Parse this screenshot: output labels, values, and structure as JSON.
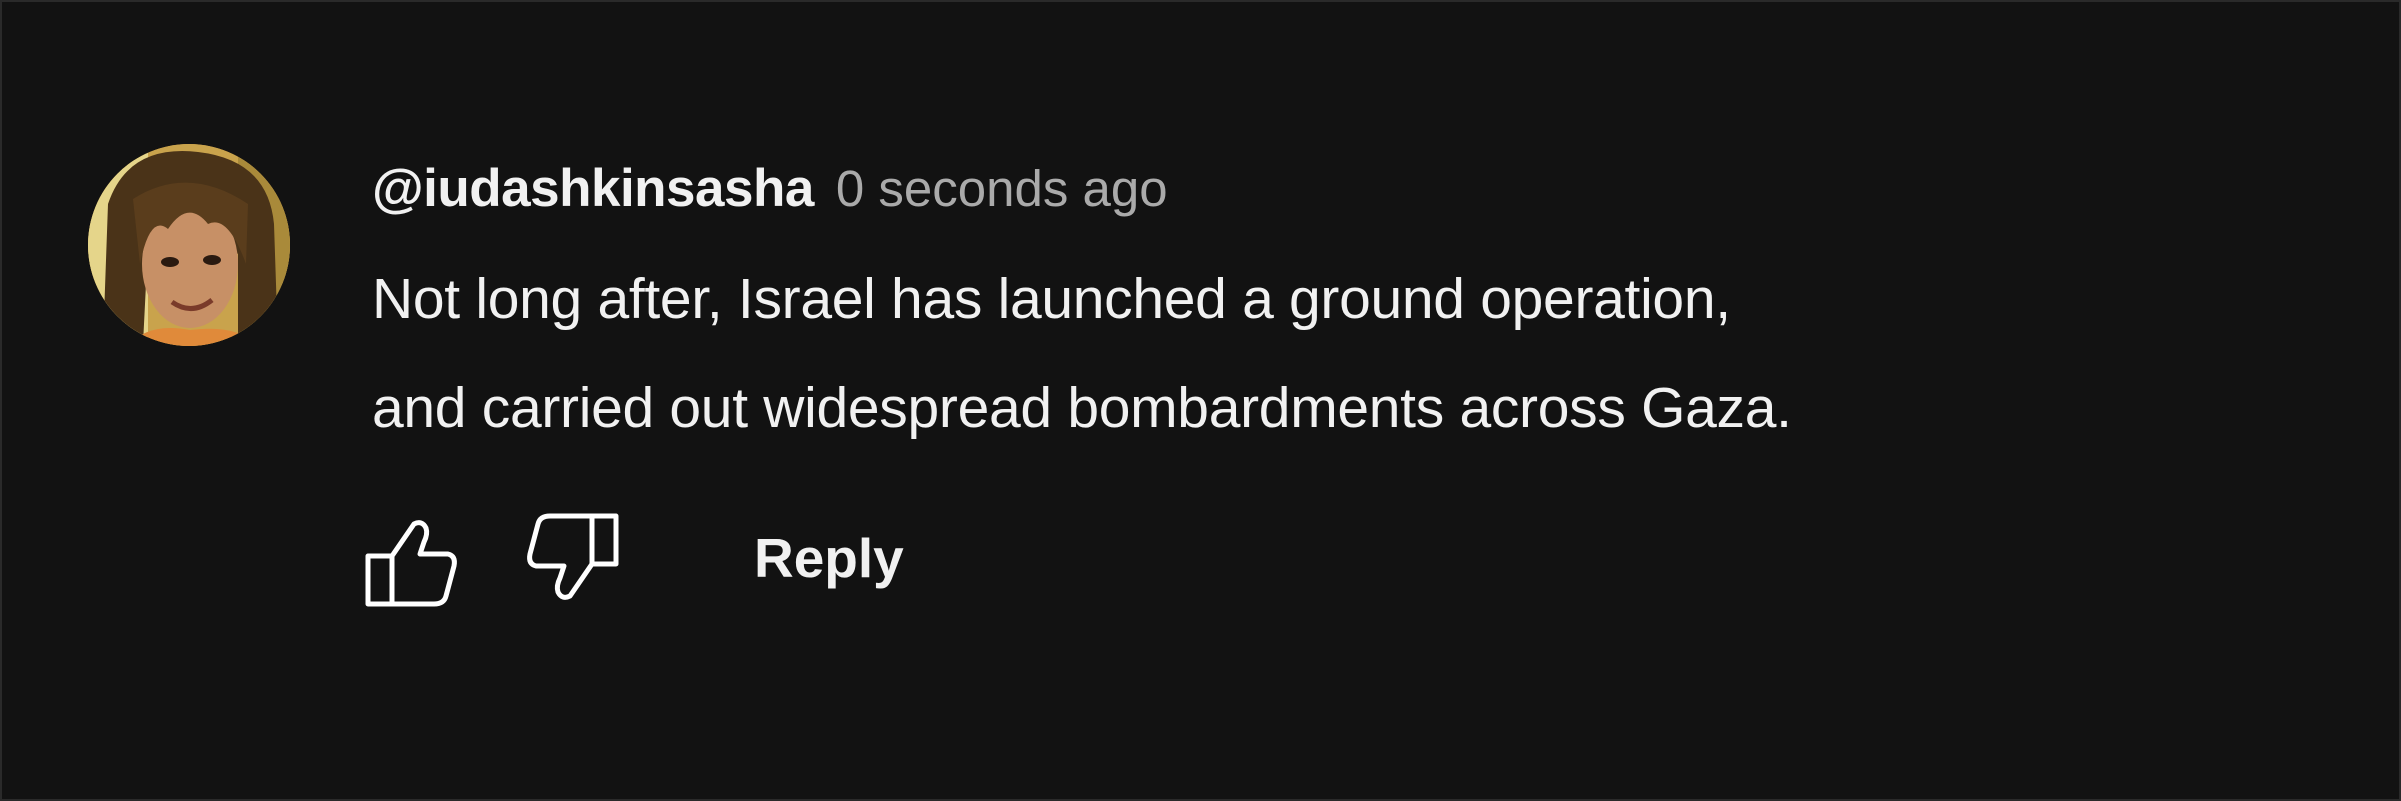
{
  "comment": {
    "author_handle": "@iudashkinsasha",
    "timestamp": "0 seconds ago",
    "text_lines": [
      "Not long after, Israel has launched a ground operation,",
      "and carried out widespread bombardments across Gaza."
    ]
  },
  "actions": {
    "like_icon": "thumbs-up-icon",
    "dislike_icon": "thumbs-down-icon",
    "reply_label": "Reply"
  },
  "colors": {
    "background": "#121212",
    "primary_text": "#f1f1f1",
    "secondary_text": "#aaaaaa"
  }
}
